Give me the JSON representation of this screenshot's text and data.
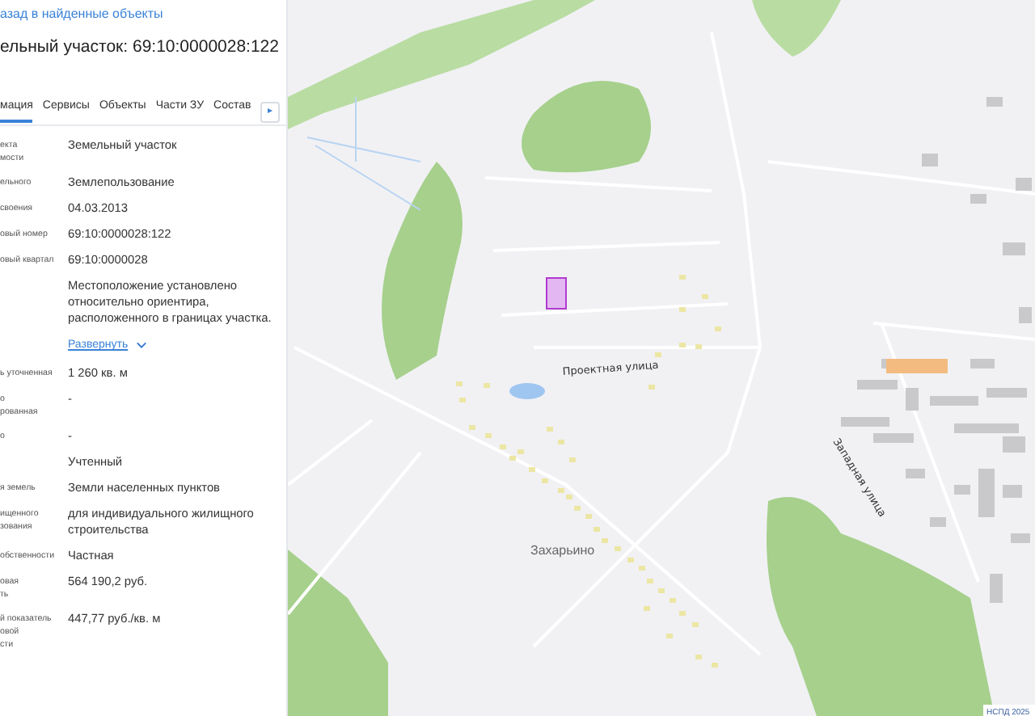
{
  "back_link": "азад в найденные объекты",
  "title": "ельный участок: 69:10:0000028:122",
  "tabs": [
    {
      "label": "мация",
      "selected": true
    },
    {
      "label": "Сервисы",
      "selected": false
    },
    {
      "label": "Объекты",
      "selected": false
    },
    {
      "label": "Части ЗУ",
      "selected": false
    },
    {
      "label": "Состав",
      "selected": false
    }
  ],
  "tabs_more": "▸",
  "fields": [
    {
      "label": "екта\nмости",
      "value": "Земельный участок"
    },
    {
      "label": "ельного",
      "value": "Землепользование"
    },
    {
      "label": "своения",
      "value": "04.03.2013"
    },
    {
      "label": "овый номер",
      "value": "69:10:0000028:122"
    },
    {
      "label": "овый квартал",
      "value": "69:10:0000028"
    },
    {
      "value": "Местоположение установлено относительно ориентира, расположенного в границах участка.",
      "expand_link": "Развернуть"
    },
    {
      "label": "ь уточненная",
      "value": "1 260 кв. м"
    },
    {
      "label": "о\nрованная",
      "value": "-"
    },
    {
      "label": "о",
      "value": "-"
    },
    {
      "value": "Учтенный"
    },
    {
      "label": "я земель",
      "value": "Земли населенных пунктов"
    },
    {
      "label": "ищенного\nзования",
      "value": "для индивидуального жилищного строительства"
    },
    {
      "label": "обственности",
      "value": "Частная"
    },
    {
      "label": "овая\nть",
      "value": "564 190,2 руб."
    },
    {
      "label": "й показатель\nовой\nсти",
      "value": "447,77 руб./кв. м"
    }
  ],
  "map": {
    "labels": [
      {
        "text": "Проектная улица",
        "kind": "street"
      },
      {
        "text": "Западная улица",
        "kind": "street"
      },
      {
        "text": "Захарьино",
        "kind": "place"
      }
    ],
    "attribution": "НСПД 2025"
  }
}
